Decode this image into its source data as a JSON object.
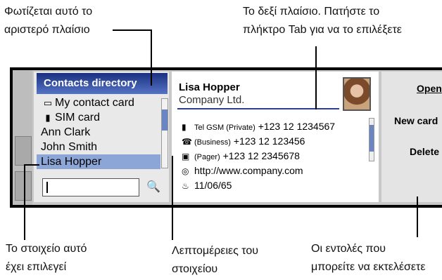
{
  "callouts": {
    "left_pane_1": "Φωτίζεται αυτό το",
    "left_pane_2": "αριστερό πλαίσιο",
    "right_pane_1": "Το δεξί πλαίσιο. Πατήστε το",
    "right_pane_2": "πλήκτρο Tab για να το επιλέξετε",
    "selected_1": "Το στοιχείο αυτό",
    "selected_2": "έχει επιλεγεί",
    "details_1": "Λεπτομέρειες του",
    "details_2": "στοιχείου",
    "commands_1": "Οι εντολές που",
    "commands_2": "μπορείτε να εκτελέσετε"
  },
  "contacts": {
    "title": "Contacts directory",
    "items": [
      {
        "label": "My contact card",
        "icon": "contact-card-icon"
      },
      {
        "label": "SIM card",
        "icon": "sim-card-icon"
      },
      {
        "label": "Ann Clark"
      },
      {
        "label": "John Smith"
      },
      {
        "label": "Lisa Hopper",
        "selected": true
      }
    ],
    "search_value": ""
  },
  "card": {
    "name": "Lisa Hopper",
    "company": "Company Ltd.",
    "details": [
      {
        "icon": "mobile-phone-icon",
        "label": "Tel GSM (Private)",
        "value": "+123 12 1234567"
      },
      {
        "icon": "fax-icon",
        "label": "(Business)",
        "value": "+123 12 123456"
      },
      {
        "icon": "pager-icon",
        "label": "(Pager)",
        "value": "+123 12 2345678"
      },
      {
        "icon": "web-icon",
        "label": "",
        "value": "http://www.company.com"
      },
      {
        "icon": "birthday-icon",
        "label": "",
        "value": "11/06/65"
      }
    ]
  },
  "commands": {
    "open": "Open",
    "new_card": "New card",
    "delete": "Delete"
  }
}
